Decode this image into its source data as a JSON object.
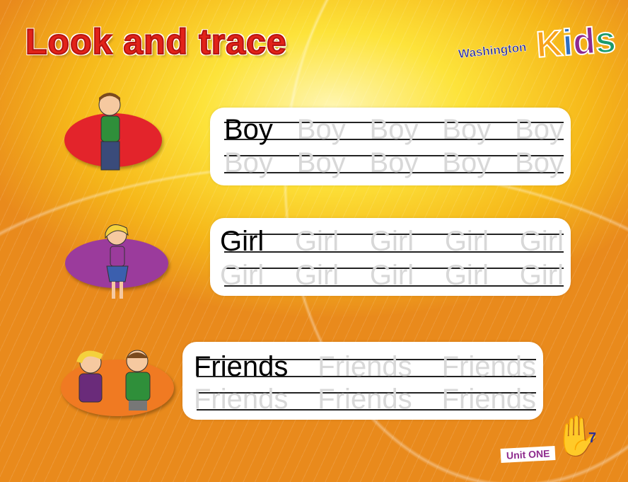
{
  "title": "Look and trace",
  "logo": {
    "prefix": "Washington",
    "name": "Kids"
  },
  "exercises": [
    {
      "word": "Boy",
      "row1": [
        "Boy",
        "Boy",
        "Boy",
        "Boy",
        "Boy"
      ],
      "row2": [
        "Boy",
        "Boy",
        "Boy",
        "Boy",
        "Boy"
      ],
      "oval_color": "#e3242b"
    },
    {
      "word": "Girl",
      "row1": [
        "Girl",
        "Girl",
        "Girl",
        "Girl",
        "Girl"
      ],
      "row2": [
        "Girl",
        "Girl",
        "Girl",
        "Girl",
        "Girl"
      ],
      "oval_color": "#9b3b9c"
    },
    {
      "word": "Friends",
      "row1": [
        "Friends",
        "Friends",
        "Friends"
      ],
      "row2": [
        "Friends",
        "Friends",
        "Friends"
      ],
      "oval_color": "#f07a22"
    }
  ],
  "footer": {
    "unit": "Unit ONE",
    "page": "7"
  }
}
